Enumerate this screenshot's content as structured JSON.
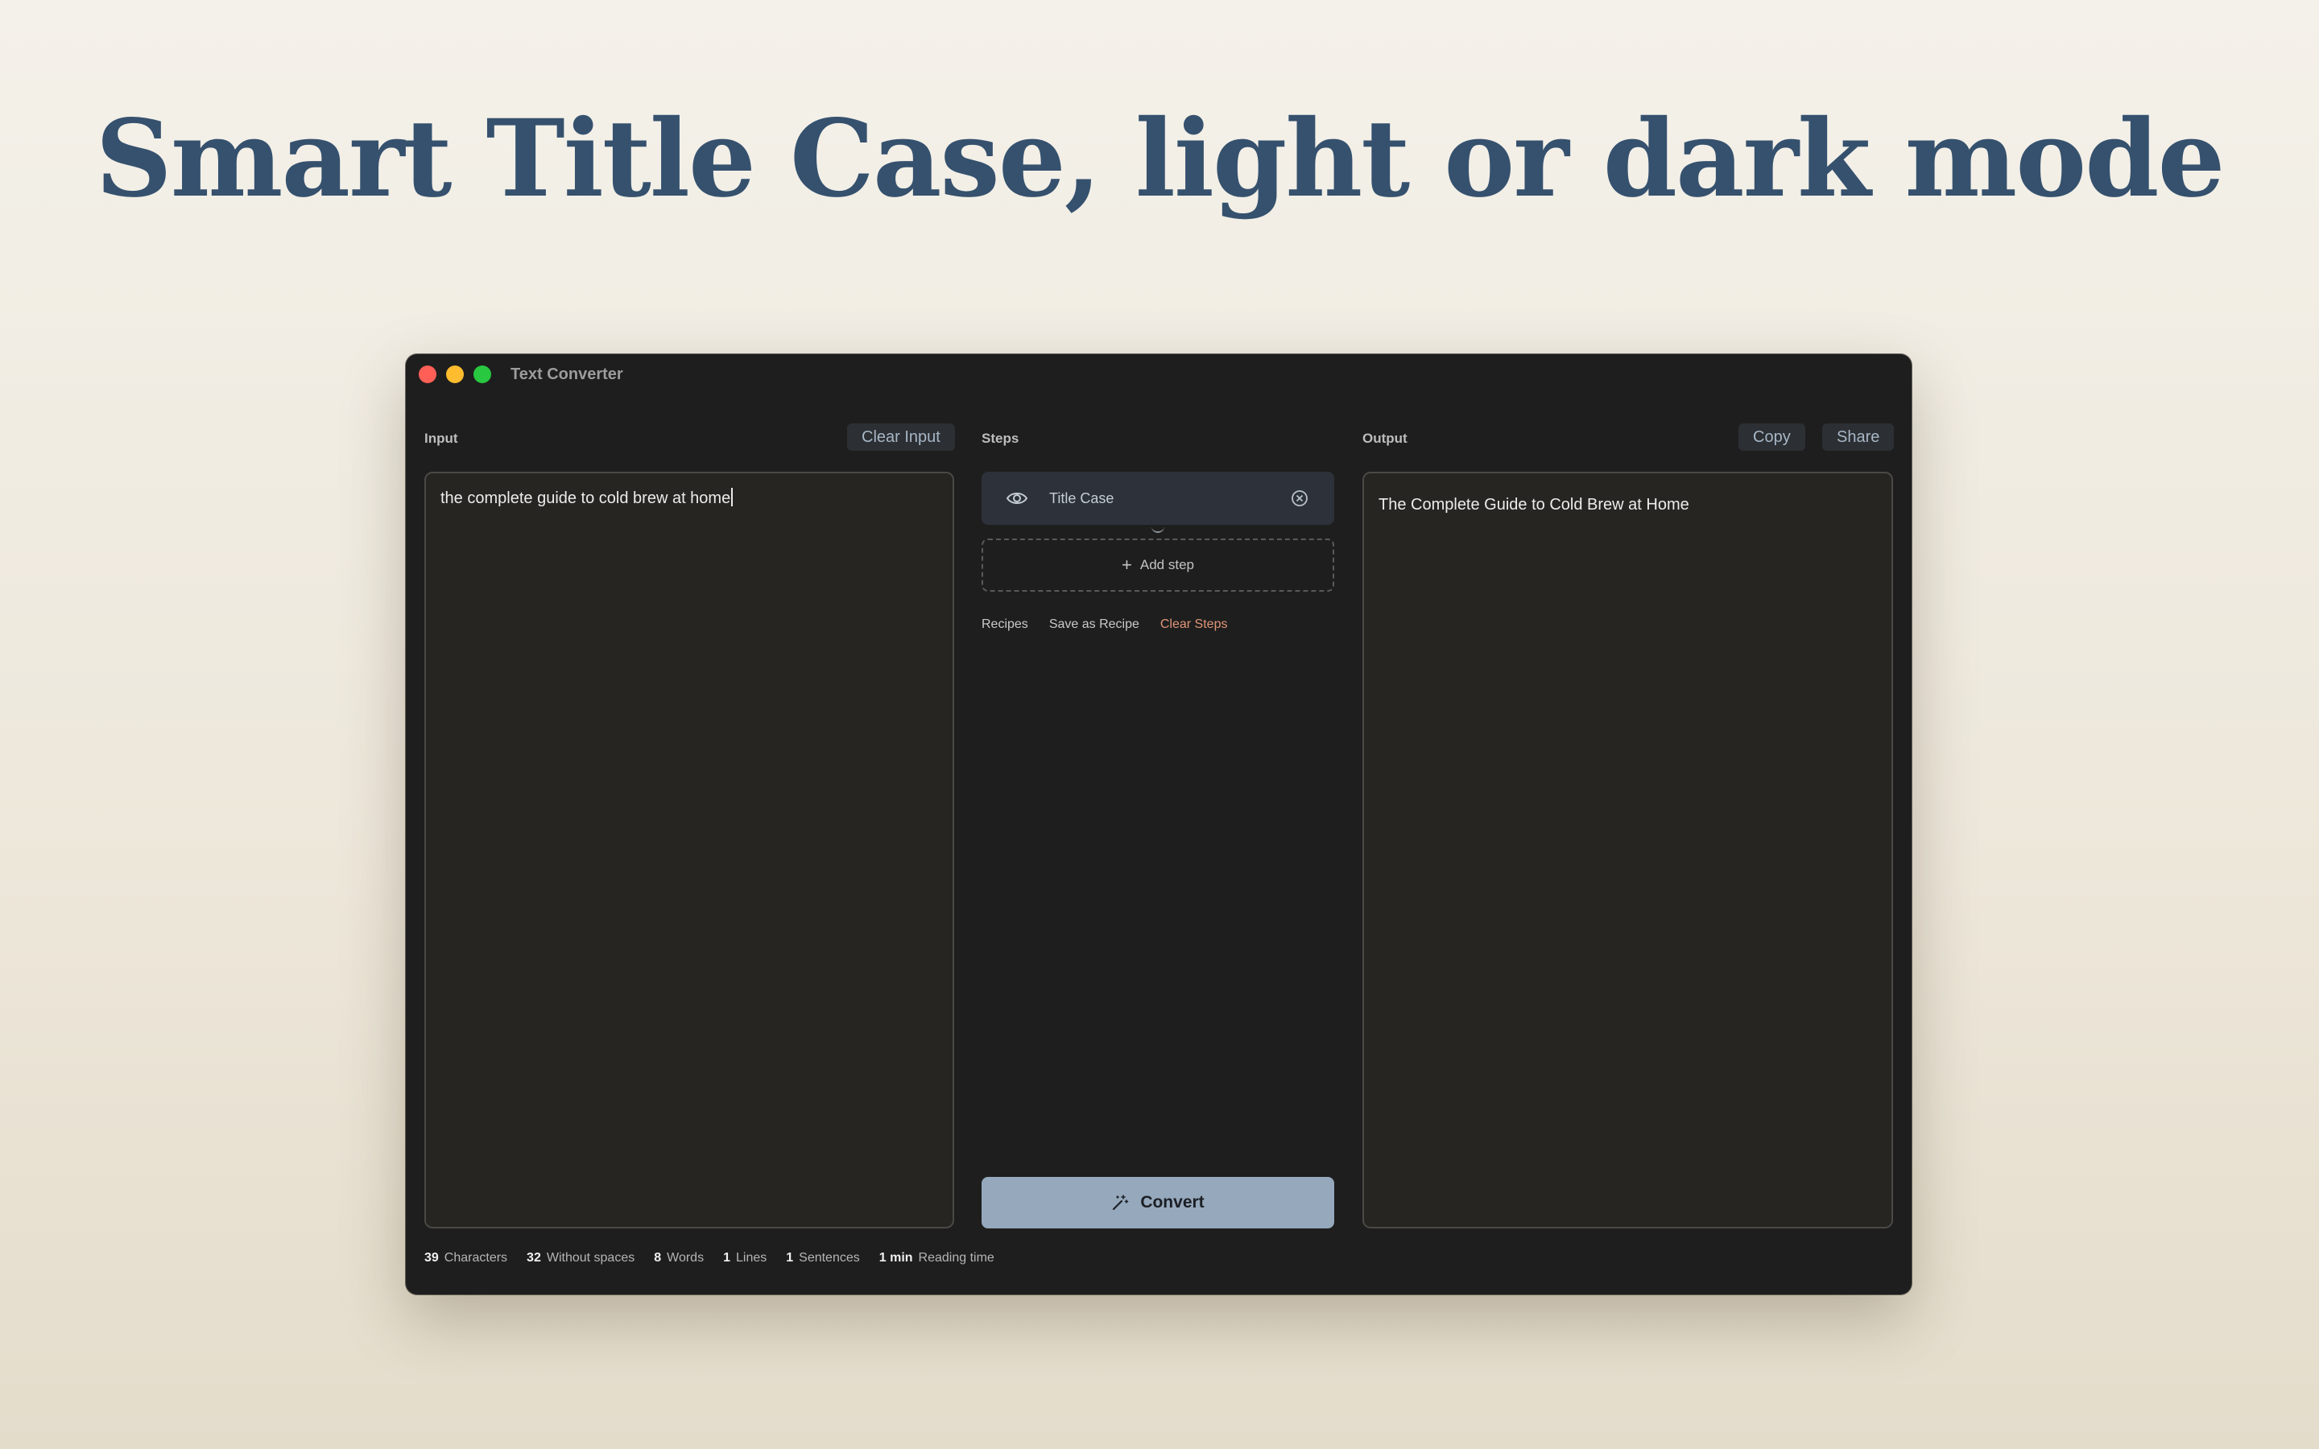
{
  "headline": "Smart Title Case, light or dark mode",
  "window": {
    "title": "Text Converter"
  },
  "input": {
    "label": "Input",
    "clear_button": "Clear Input",
    "value": "the complete guide to cold brew at home"
  },
  "steps": {
    "label": "Steps",
    "items": [
      {
        "name": "Title Case",
        "icon": "eye-icon",
        "remove_icon": "close-circle-icon"
      }
    ],
    "add_step": "Add step",
    "links": {
      "recipes": "Recipes",
      "save_recipe": "Save as Recipe",
      "clear_steps": "Clear Steps"
    },
    "convert_button": "Convert"
  },
  "output": {
    "label": "Output",
    "copy_button": "Copy",
    "share_button": "Share",
    "value": "The Complete Guide to Cold Brew at Home"
  },
  "stats": [
    {
      "value": "39",
      "label": "Characters"
    },
    {
      "value": "32",
      "label": "Without spaces"
    },
    {
      "value": "8",
      "label": "Words"
    },
    {
      "value": "1",
      "label": "Lines"
    },
    {
      "value": "1",
      "label": "Sentences"
    },
    {
      "value": "1 min",
      "label": "Reading time"
    }
  ],
  "colors": {
    "headline": "#35516e",
    "window_bg": "#1e1e1e",
    "convert_bg": "#95a8bc",
    "danger_link": "#e09578"
  }
}
